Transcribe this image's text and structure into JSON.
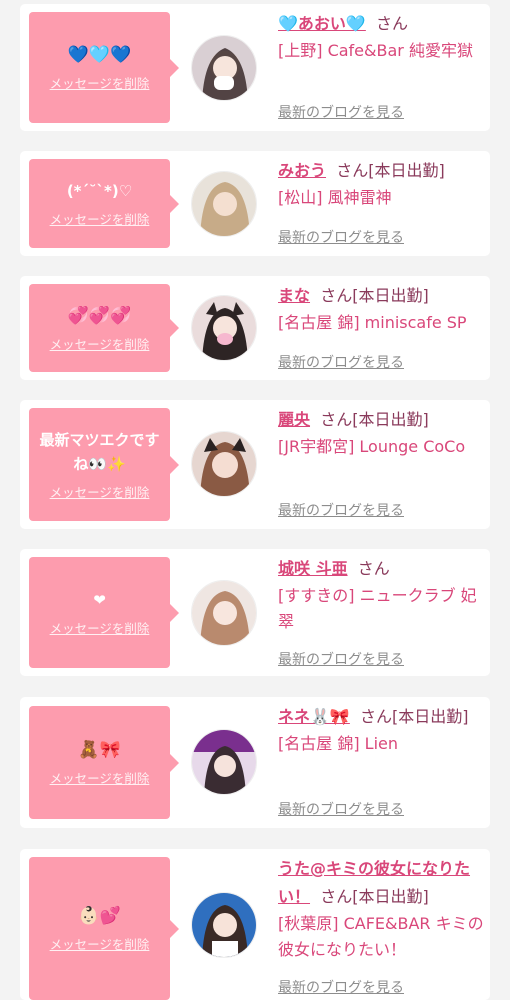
{
  "delete_label": "メッセージを削除",
  "blog_label": "最新のブログを見る",
  "san": "さん",
  "cards": [
    {
      "name": "🩵あおい🩵",
      "status": "",
      "shop": "[上野] Cafe&Bar 純愛牢獄",
      "message": "💙🩵💙",
      "avatar_icon": "profile-photo"
    },
    {
      "name": "みおう",
      "status": "[本日出勤]",
      "shop": "[松山] 風神雷神",
      "message": "(*´˘`*)♡",
      "avatar_icon": "profile-photo"
    },
    {
      "name": "まな",
      "status": "[本日出勤]",
      "shop": "[名古屋 錦] miniscafe SP",
      "message": "💞💞💞",
      "avatar_icon": "profile-photo"
    },
    {
      "name": "麗央",
      "status": "[本日出勤]",
      "shop": "[JR宇都宮] Lounge CoCo",
      "message": "最新マツエクですね👀✨",
      "avatar_icon": "profile-photo"
    },
    {
      "name": "城咲 斗亜",
      "status": "",
      "shop": "[すすきの] ニュークラブ 妃翠",
      "message": "❤",
      "avatar_icon": "profile-photo"
    },
    {
      "name": "ネネ🐰🎀",
      "status": "[本日出勤]",
      "shop": "[名古屋 錦] Lien",
      "message": "🧸🎀",
      "avatar_icon": "profile-photo"
    },
    {
      "name": "うた@キミの彼女になりたい！",
      "status": "[本日出勤]",
      "shop": "[秋葉原] CAFE&BAR キミの彼女になりたい！",
      "message": "👶🏻💕",
      "avatar_icon": "profile-photo"
    }
  ]
}
